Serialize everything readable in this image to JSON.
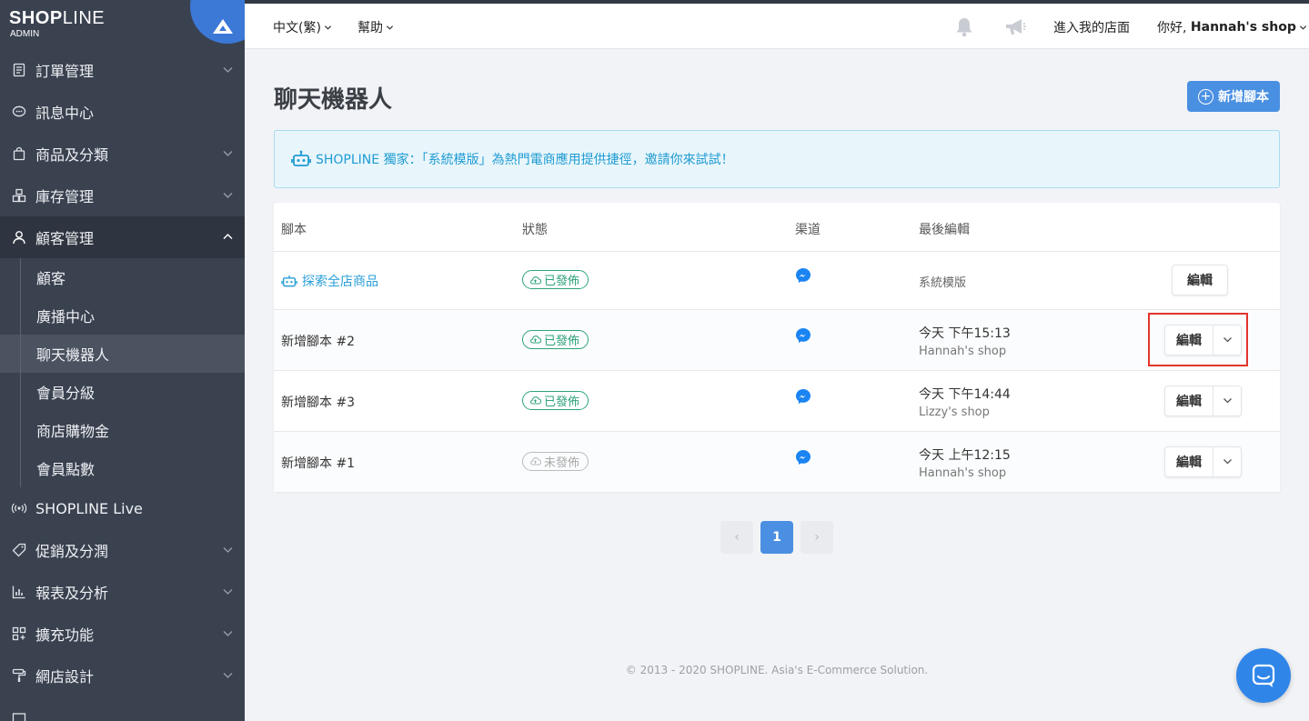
{
  "brand": {
    "name_bold": "SHOP",
    "name_thin": "LINE",
    "subtitle": "ADMIN"
  },
  "colors": {
    "sidebar_bg": "#3a4250",
    "accent": "#4a90e2",
    "published": "#2ea37a",
    "link": "#2a9fd8",
    "highlight": "#e2352b"
  },
  "sidebar": {
    "items": [
      {
        "label": "訂單管理",
        "icon": "receipt-icon",
        "has_chevron": true
      },
      {
        "label": "訊息中心",
        "icon": "chat-bubble-icon",
        "has_chevron": false
      },
      {
        "label": "商品及分類",
        "icon": "shopping-bag-icon",
        "has_chevron": true
      },
      {
        "label": "庫存管理",
        "icon": "inventory-icon",
        "has_chevron": true
      },
      {
        "label": "顧客管理",
        "icon": "user-icon",
        "has_chevron": true,
        "expanded": true
      }
    ],
    "sub_items": [
      "顧客",
      "廣播中心",
      "聊天機器人",
      "會員分級",
      "商店購物金",
      "會員點數"
    ],
    "current_sub": "聊天機器人",
    "items_after": [
      {
        "label": "SHOPLINE Live",
        "icon": "broadcast-icon",
        "has_chevron": false
      },
      {
        "label": "促銷及分潤",
        "icon": "tag-icon",
        "has_chevron": true
      },
      {
        "label": "報表及分析",
        "icon": "bar-chart-icon",
        "has_chevron": true
      },
      {
        "label": "擴充功能",
        "icon": "apps-grid-icon",
        "has_chevron": true
      },
      {
        "label": "網店設計",
        "icon": "paint-roller-icon",
        "has_chevron": true
      },
      {
        "label": "",
        "icon": "more-icon",
        "has_chevron": false
      }
    ]
  },
  "header": {
    "language": "中文(繁)",
    "help": "幫助",
    "enter_store": "進入我的店面",
    "greeting": "你好,",
    "shop_name": "Hannah's shop"
  },
  "page": {
    "title": "聊天機器人",
    "add_button": "新增腳本",
    "banner_text": "SHOPLINE 獨家：「系統模版」為熱門電商應用提供捷徑，邀請你來試試！"
  },
  "table": {
    "headers": [
      "腳本",
      "狀態",
      "渠道",
      "最後編輯"
    ],
    "rows": [
      {
        "name": "探索全店商品",
        "is_template": true,
        "status": "已發佈",
        "published": true,
        "channel": "messenger-icon",
        "time": "",
        "editor": "系統模版",
        "edit_label": "編輯",
        "has_dropdown": false
      },
      {
        "name": "新增腳本 #2",
        "is_template": false,
        "status": "已發佈",
        "published": true,
        "channel": "messenger-icon",
        "time": "今天 下午15:13",
        "editor": "Hannah's shop",
        "edit_label": "編輯",
        "has_dropdown": true
      },
      {
        "name": "新增腳本 #3",
        "is_template": false,
        "status": "已發佈",
        "published": true,
        "channel": "messenger-icon",
        "time": "今天 下午14:44",
        "editor": "Lizzy's shop",
        "edit_label": "編輯",
        "has_dropdown": true
      },
      {
        "name": "新增腳本 #1",
        "is_template": false,
        "status": "未發佈",
        "published": false,
        "channel": "messenger-icon",
        "time": "今天 上午12:15",
        "editor": "Hannah's shop",
        "edit_label": "編輯",
        "has_dropdown": true
      }
    ]
  },
  "pagination": {
    "prev": "‹",
    "current": "1",
    "next": "›"
  },
  "footer": "© 2013 - 2020 SHOPLINE. Asia's E-Commerce Solution."
}
